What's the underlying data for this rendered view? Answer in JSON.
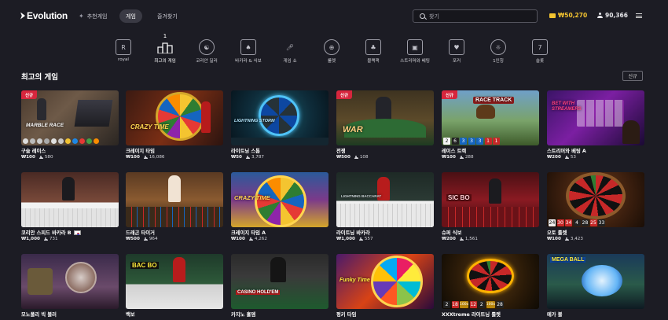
{
  "header": {
    "logo": "Evolution",
    "nav": [
      {
        "label": "추천게임",
        "icon": "sparkle-icon"
      },
      {
        "label": "게임",
        "active": true
      },
      {
        "label": "즐겨찾기"
      }
    ],
    "search_placeholder": "찾기",
    "balance": "₩50,270",
    "players": "90,366"
  },
  "categories": [
    {
      "label": "royal",
      "icon": "R"
    },
    {
      "label": "최고의 게임",
      "icon": "podium",
      "active": true,
      "top": "1"
    },
    {
      "label": "코리안 딜러",
      "icon": "korean-dealer"
    },
    {
      "label": "바카라 & 식보",
      "icon": "cards"
    },
    {
      "label": "게임 쇼",
      "icon": "microphone"
    },
    {
      "label": "룰렛",
      "icon": "roulette"
    },
    {
      "label": "블랙잭",
      "icon": "blackjack"
    },
    {
      "label": "스트리머와 베팅",
      "icon": "streamer"
    },
    {
      "label": "포커",
      "icon": "poker"
    },
    {
      "label": "1인칭",
      "icon": "first-person"
    },
    {
      "label": "슬롯",
      "icon": "slot"
    }
  ],
  "section": {
    "title": "최고의 게임",
    "new_button": "신규"
  },
  "new_badge": "신규",
  "games": [
    {
      "name": "구슬 레이스",
      "bet": "₩100",
      "players": "580",
      "new": true,
      "scene": "marble"
    },
    {
      "name": "크레이지 타임",
      "bet": "₩100",
      "players": "16,086",
      "scene": "crazy"
    },
    {
      "name": "라이트닝 스톰",
      "bet": "₩50",
      "players": "3,787",
      "scene": "storm"
    },
    {
      "name": "전쟁",
      "bet": "₩500",
      "players": "108",
      "new": true,
      "scene": "war"
    },
    {
      "name": "레이스 트랙",
      "bet": "₩100",
      "players": "288",
      "new": true,
      "scene": "race"
    },
    {
      "name": "스트리머와 베팅 A",
      "bet": "₩200",
      "players": "53",
      "scene": "streamer"
    },
    {
      "name": "코리안 스피드 바카라 B",
      "bet": "₩1,000",
      "players": "731",
      "flag": true,
      "scene": "kbacc"
    },
    {
      "name": "드래곤 타이거",
      "bet": "₩500",
      "players": "964",
      "scene": "dragon"
    },
    {
      "name": "크레이지 타임 A",
      "bet": "₩100",
      "players": "4,262",
      "scene": "crazya"
    },
    {
      "name": "라이트닝 바카라",
      "bet": "₩1,000",
      "players": "557",
      "scene": "lbacc"
    },
    {
      "name": "슈퍼 식보",
      "bet": "₩200",
      "players": "1,561",
      "scene": "sicbo"
    },
    {
      "name": "오토 룰렛",
      "bet": "₩100",
      "players": "3,423",
      "scene": "auto"
    },
    {
      "name": "모노폴리 빅 볼러",
      "scene": "mono"
    },
    {
      "name": "백보",
      "scene": "bacbo"
    },
    {
      "name": "카지노 홀뎀",
      "scene": "holdem"
    },
    {
      "name": "펑키 타임",
      "scene": "funky"
    },
    {
      "name": "XXXtreme 라이트닝 룰렛",
      "scene": "xxx"
    },
    {
      "name": "메가 볼",
      "scene": "mega"
    }
  ],
  "scene_text": {
    "marble": "MARBLE RACE",
    "crazy": "CRAZY TIME",
    "storm": "LIGHTNING STORM",
    "war": "WAR",
    "race": "RACE TRACK",
    "streamer": "BET WITH STREAMERS",
    "crazya": "CRAZY TIME",
    "lbacc": "LIGHTNING BACCARAT",
    "sicbo": "SIC BO",
    "bacbo": "BAC BO",
    "holdem": "CASINO HOLD'EM",
    "funky": "Funky Time",
    "mega": "MEGA BALL"
  },
  "result_rows": {
    "race": [
      "2",
      "6",
      "3",
      "3",
      "3",
      "1",
      "1"
    ],
    "auto": [
      "24",
      "30",
      "34",
      "4",
      "28",
      "25",
      "33"
    ],
    "xxx": [
      "2",
      "18",
      "100x",
      "12",
      "2",
      "100x",
      "28"
    ]
  },
  "colors": {
    "accent_gold": "#f4c430",
    "new_red": "#d7263d",
    "bg": "#1c1c24"
  }
}
